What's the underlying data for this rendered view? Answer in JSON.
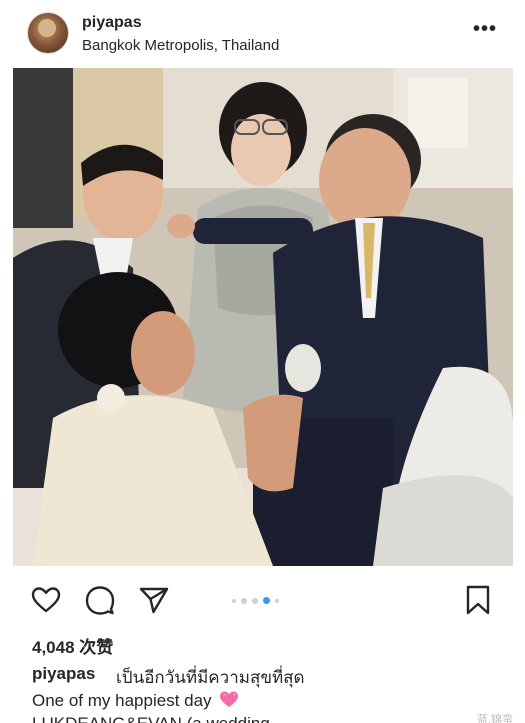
{
  "post": {
    "username": "piyapas",
    "location": "Bangkok Metropolis, Thailand",
    "more_icon": "more-horizontal-icon",
    "likes": "4,048 次赞",
    "caption_username": "piyapas",
    "caption_thai": "เป็นอีกวันที่มีความสุขที่สุด",
    "caption_line2": "One of my happiest day",
    "caption_line3": "LUKDEANG&EVAN (a wedding",
    "watermark": "蓝.锦蛮",
    "carousel": {
      "count": 5,
      "active_index": 3
    }
  },
  "actions": {
    "like": "heart-outline-icon",
    "comment": "comment-bubble-icon",
    "share": "send-paper-plane-icon",
    "save": "bookmark-outline-icon"
  },
  "colors": {
    "text": "#262626",
    "active_dot": "#3897f0",
    "inactive_dot": "#cfcfcf",
    "heart_emoji": "#f36ba8"
  }
}
